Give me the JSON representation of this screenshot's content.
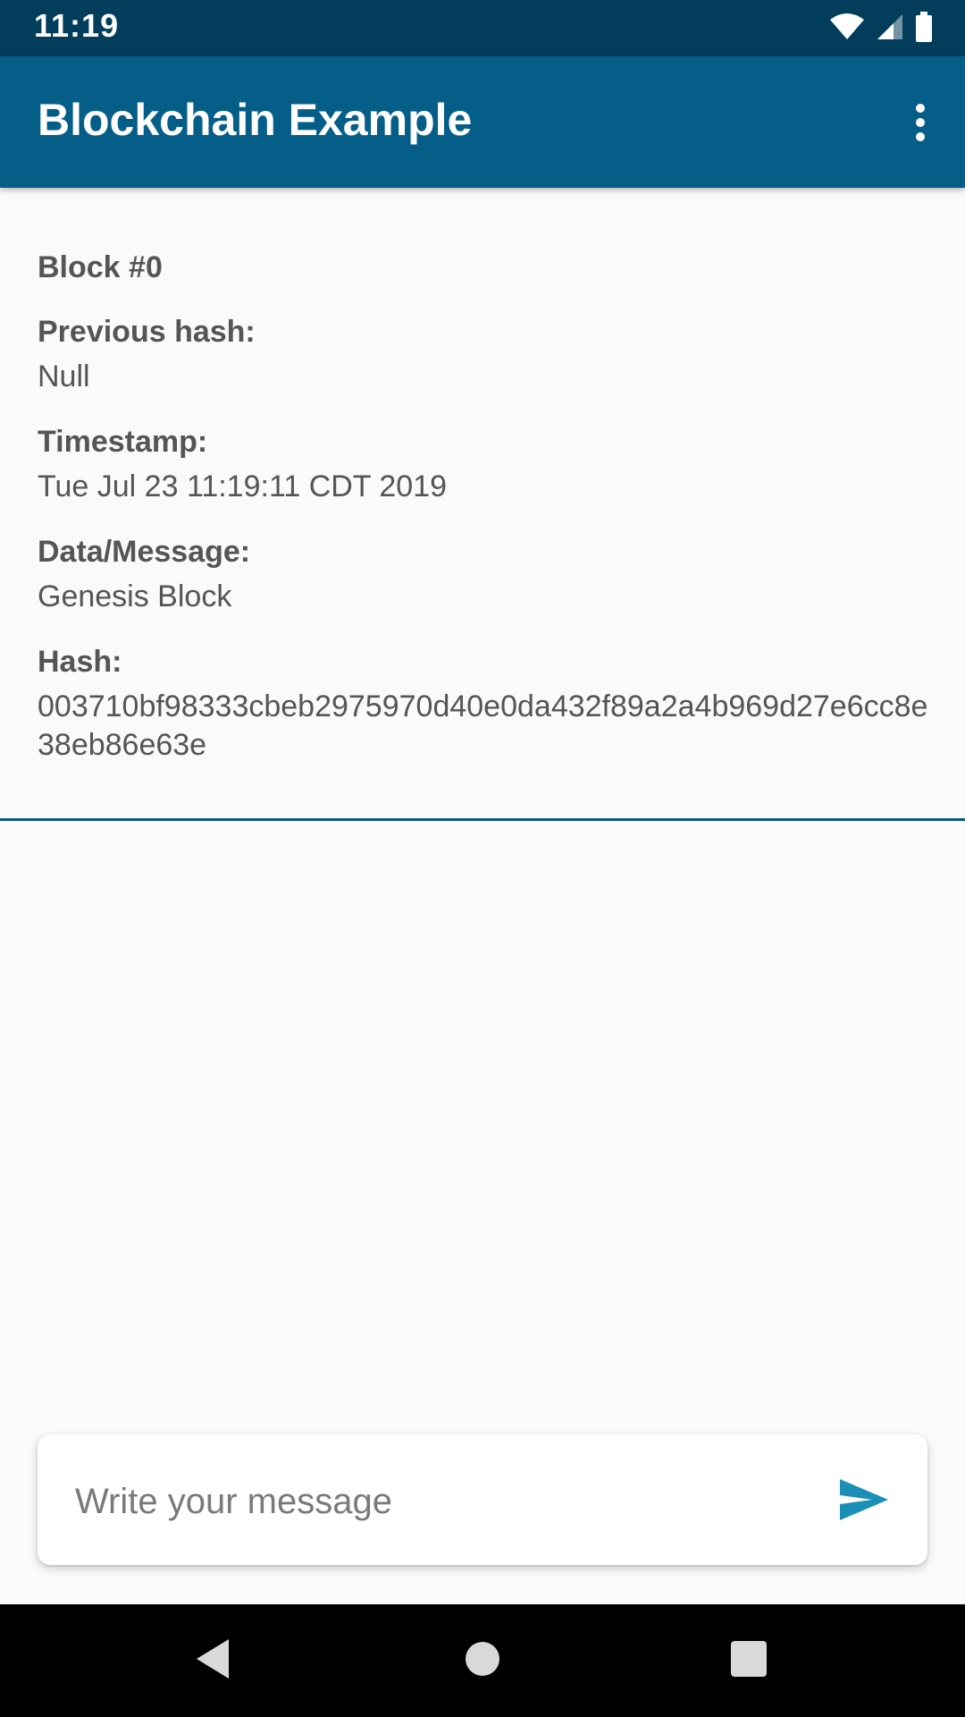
{
  "status_bar": {
    "time": "11:19",
    "icons": [
      "wifi-icon",
      "cellular-signal-icon",
      "battery-icon"
    ]
  },
  "app_bar": {
    "title": "Blockchain Example",
    "overflow_icon": "more-vert-icon"
  },
  "block": {
    "heading": "Block #0",
    "previous_hash_label": "Previous hash:",
    "previous_hash_value": "Null",
    "timestamp_label": "Timestamp:",
    "timestamp_value": "Tue Jul 23 11:19:11 CDT 2019",
    "data_label": "Data/Message:",
    "data_value": "Genesis Block",
    "hash_label": "Hash:",
    "hash_value": "003710bf98333cbeb2975970d40e0da432f89a2a4b969d27e6cc8e38eb86e63e"
  },
  "composer": {
    "placeholder": "Write your message",
    "value": "",
    "send_icon": "send-icon"
  },
  "nav_bar": {
    "icons": [
      "back-icon",
      "home-icon",
      "recents-icon"
    ]
  },
  "colors": {
    "status_bar": "#023d5c",
    "app_bar": "#045e87",
    "accent": "#1b8fb5",
    "background": "#fafafa",
    "text": "#555555"
  }
}
